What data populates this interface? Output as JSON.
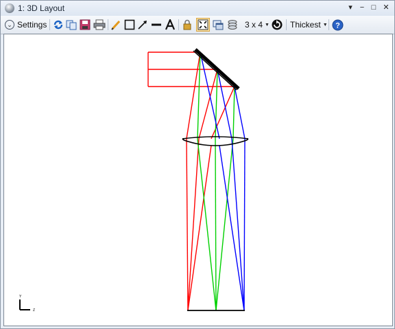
{
  "window": {
    "title": "1: 3D Layout",
    "controls": {
      "menu": "▾",
      "minimize": "−",
      "maximize": "□",
      "close": "✕"
    }
  },
  "toolbar": {
    "settings_label": "Settings",
    "config_label": "3 x 4",
    "thickness_label": "Thickest",
    "icons": [
      "refresh-icon",
      "copy-icon",
      "save-icon",
      "print-icon",
      "pencil-icon",
      "rectangle-icon",
      "arrow-icon",
      "line-icon",
      "text-icon",
      "lock-icon",
      "fit-view-icon",
      "window-icon",
      "layers-icon",
      "rotate-icon",
      "help-icon"
    ]
  },
  "canvas": {
    "axis_labels": {
      "vertical": "Y",
      "horizontal": "Z"
    },
    "ray_colors": {
      "field1": "#ff0000",
      "field2": "#00d000",
      "field3": "#0000ff"
    }
  }
}
